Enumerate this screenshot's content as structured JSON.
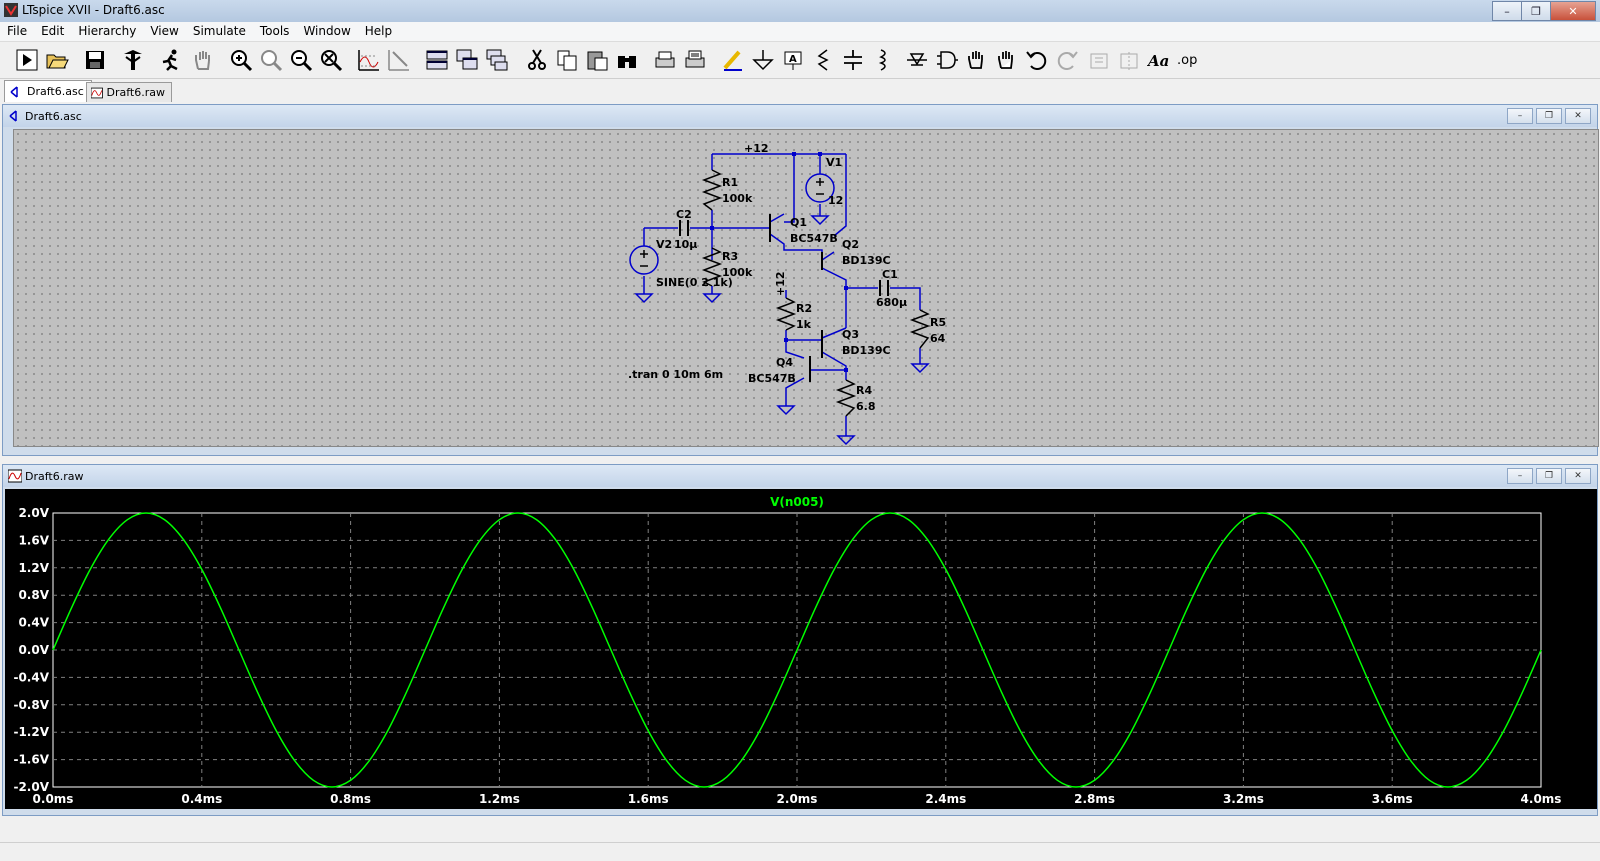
{
  "app": {
    "title": "LTspice XVII - Draft6.asc"
  },
  "menu": [
    "File",
    "Edit",
    "Hierarchy",
    "View",
    "Simulate",
    "Tools",
    "Window",
    "Help"
  ],
  "toolbar_icons": [
    "run-icon",
    "open-icon",
    "save-icon",
    "control-panel-icon",
    "run-man-icon",
    "pan-hand-icon",
    "zoom-in-icon",
    "zoom-area-icon",
    "zoom-out-icon",
    "zoom-cancel-icon",
    "autorange-icon",
    "delete-plot-icon",
    "tile-horizontal-icon",
    "cascade-icon",
    "tile-vertical-icon",
    "cut-icon",
    "copy-icon",
    "paste-icon",
    "find-icon",
    "print-setup-icon",
    "print-icon",
    "wire-icon",
    "ground-icon",
    "label-icon",
    "resistor-icon",
    "capacitor-icon",
    "inductor-icon",
    "diode-icon",
    "component-icon",
    "move-icon",
    "drag-icon",
    "undo-icon",
    "redo-icon",
    "rotate-icon",
    "mirror-icon",
    "text-icon",
    "spice-directive-icon"
  ],
  "toolbar_text": {
    "spice_directive": ".op",
    "text": "Aa"
  },
  "tabs": [
    {
      "label": "Draft6.asc"
    },
    {
      "label": "Draft6.raw"
    }
  ],
  "schematic_window": {
    "title": "Draft6.asc"
  },
  "waveform_window": {
    "title": "Draft6.raw"
  },
  "schematic": {
    "labels": {
      "vcc_top": "+12",
      "vcc_r2": "+12",
      "v1_name": "V1",
      "v1_value": "12",
      "r1_name": "R1",
      "r1_value": "100k",
      "r3_name": "R3",
      "r3_value": "100k",
      "c2_name": "C2",
      "c2_value": "10µ",
      "v2_name": "V2",
      "v2_value": "SINE(0 2 1k)",
      "q1_name": "Q1",
      "q1_model": "BC547B",
      "q2_name": "Q2",
      "q2_model": "BD139C",
      "q3_name": "Q3",
      "q3_model": "BD139C",
      "q4_name": "Q4",
      "q4_model": "BC547B",
      "c1_name": "C1",
      "c1_value": "680µ",
      "r5_name": "R5",
      "r5_value": "64",
      "r2_name": "R2",
      "r2_value": "1k",
      "r4_name": "R4",
      "r4_value": "6.8",
      "directive": ".tran 0 10m 6m"
    }
  },
  "chart_data": {
    "type": "line",
    "title": "V(n005)",
    "xlabel": "",
    "ylabel": "",
    "xlim": [
      0,
      4.0
    ],
    "ylim": [
      -2.0,
      2.0
    ],
    "x_unit": "ms",
    "y_unit": "V",
    "x_ticks": [
      "0.0ms",
      "0.4ms",
      "0.8ms",
      "1.2ms",
      "1.6ms",
      "2.0ms",
      "2.4ms",
      "2.8ms",
      "3.2ms",
      "3.6ms",
      "4.0ms"
    ],
    "y_ticks": [
      "2.0V",
      "1.6V",
      "1.2V",
      "0.8V",
      "0.4V",
      "0.0V",
      "-0.4V",
      "-0.8V",
      "-1.2V",
      "-1.6V",
      "-2.0V"
    ],
    "grid": true,
    "series": [
      {
        "name": "V(n005)",
        "color": "#00ff00",
        "x": [
          0.0,
          0.05,
          0.1,
          0.15,
          0.2,
          0.25,
          0.3,
          0.35,
          0.4,
          0.45,
          0.5,
          0.55,
          0.6,
          0.65,
          0.7,
          0.75,
          0.8,
          0.85,
          0.9,
          0.95,
          1.0,
          1.05,
          1.1,
          1.15,
          1.2,
          1.25,
          1.3,
          1.35,
          1.4,
          1.45,
          1.5,
          1.55,
          1.6,
          1.65,
          1.7,
          1.75,
          1.8,
          1.85,
          1.9,
          1.95,
          2.0,
          2.05,
          2.1,
          2.15,
          2.2,
          2.25,
          2.3,
          2.35,
          2.4,
          2.45,
          2.5,
          2.55,
          2.6,
          2.65,
          2.7,
          2.75,
          2.8,
          2.85,
          2.9,
          2.95,
          3.0,
          3.05,
          3.1,
          3.15,
          3.2,
          3.25,
          3.3,
          3.35,
          3.4,
          3.45,
          3.5,
          3.55,
          3.6,
          3.65,
          3.7,
          3.75,
          3.8,
          3.85,
          3.9,
          3.95,
          4.0
        ],
        "y": [
          0.0,
          0.618,
          1.176,
          1.618,
          1.902,
          2.0,
          1.902,
          1.618,
          1.176,
          0.618,
          0.0,
          -0.618,
          -1.176,
          -1.618,
          -1.902,
          -2.0,
          -1.902,
          -1.618,
          -1.176,
          -0.618,
          0.0,
          0.618,
          1.176,
          1.618,
          1.902,
          2.0,
          1.902,
          1.618,
          1.176,
          0.618,
          0.0,
          -0.618,
          -1.176,
          -1.618,
          -1.902,
          -2.0,
          -1.902,
          -1.618,
          -1.176,
          -0.618,
          0.0,
          0.618,
          1.176,
          1.618,
          1.902,
          2.0,
          1.902,
          1.618,
          1.176,
          0.618,
          0.0,
          -0.618,
          -1.176,
          -1.618,
          -1.902,
          -2.0,
          -1.902,
          -1.618,
          -1.176,
          -0.618,
          0.0,
          0.618,
          1.176,
          1.618,
          1.902,
          2.0,
          1.902,
          1.618,
          1.176,
          0.618,
          0.0,
          -0.618,
          -1.176,
          -1.618,
          -1.902,
          -2.0,
          -1.902,
          -1.618,
          -1.176,
          -0.618,
          0.0
        ]
      }
    ]
  },
  "colors": {
    "wire": "#0000cc",
    "trace": "#00ff00",
    "plot_bg": "#000000",
    "schematic_bg": "#c0c0c0"
  }
}
